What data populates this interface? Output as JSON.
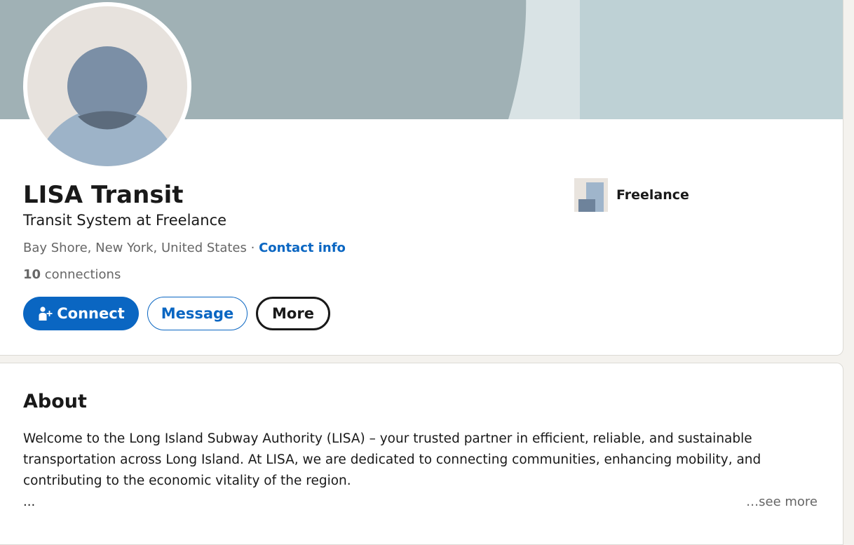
{
  "profile": {
    "name": "LISA Transit",
    "headline": "Transit System at Freelance",
    "location": "Bay Shore, New York, United States",
    "separator": " · ",
    "contact_info_label": "Contact info",
    "connections_count": "10",
    "connections_label": " connections",
    "avatar_icon": "default-person-avatar",
    "company": {
      "name": "Freelance",
      "logo_icon": "company-logo-placeholder"
    }
  },
  "actions": {
    "connect_label": "Connect",
    "connect_icon": "add-person-icon",
    "message_label": "Message",
    "more_label": "More"
  },
  "about": {
    "title": "About",
    "text": "Welcome to the Long Island Subway Authority (LISA) – your trusted partner in efficient, reliable, and sustainable transportation across Long Island. At LISA, we are dedicated to connecting communities, enhancing mobility, and contributing to the economic vitality of the region.",
    "ellipsis": "...",
    "see_more_label": "…see more"
  },
  "colors": {
    "accent": "#0a66c2",
    "banner_dark": "#a0b1b5",
    "banner_light": "#bed1d5",
    "banner_strip": "#d9e3e5",
    "avatar_bg": "#e7e2dd",
    "avatar_head": "#7b8fa6",
    "avatar_body": "#9db3c8"
  }
}
